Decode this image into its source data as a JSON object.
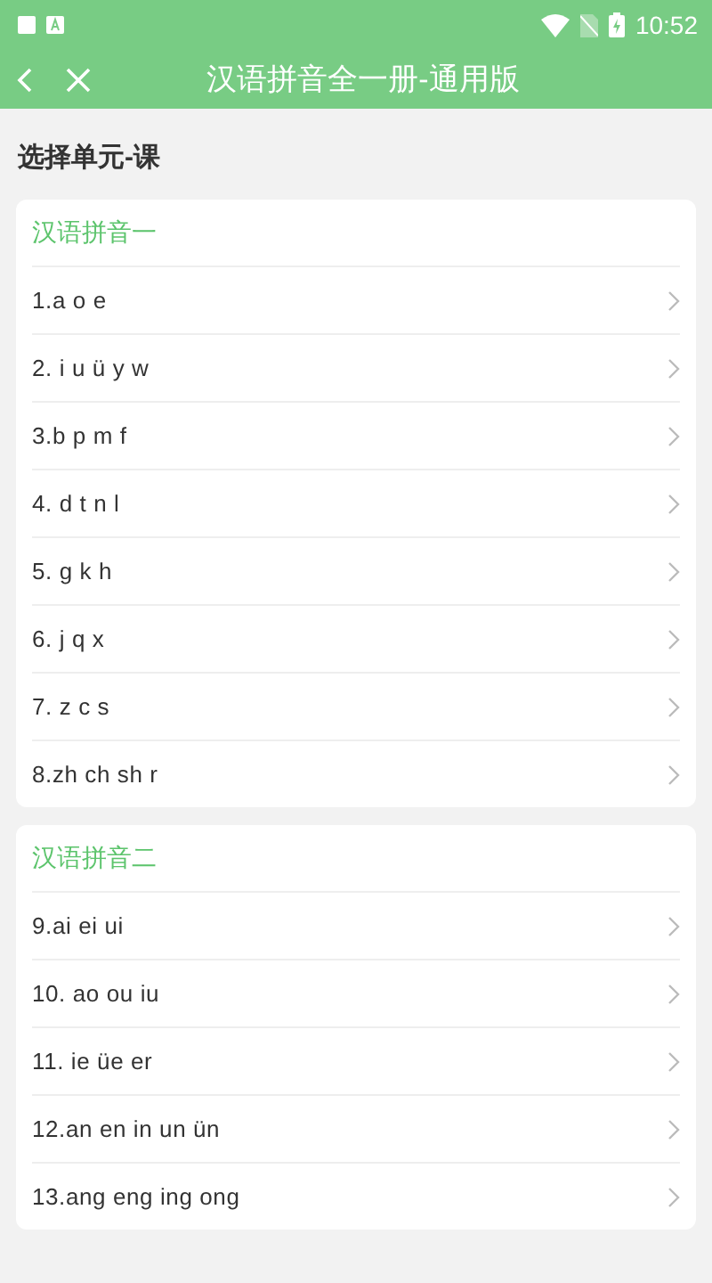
{
  "status_bar": {
    "time": "10:52"
  },
  "app_bar": {
    "title": "汉语拼音全一册-通用版"
  },
  "heading": "选择单元-课",
  "units": [
    {
      "title": "汉语拼音一",
      "lessons": [
        "1.a o e",
        "2. i u ü y w",
        "3.b p m f",
        "4. d t n l",
        "5. g k h",
        "6. j q x",
        "7. z c s",
        "8.zh ch sh r"
      ]
    },
    {
      "title": "汉语拼音二",
      "lessons": [
        "9.ai ei ui",
        "10. ao ou iu",
        "11. ie üe er",
        "12.an en in un ün",
        "13.ang eng ing ong"
      ]
    }
  ]
}
